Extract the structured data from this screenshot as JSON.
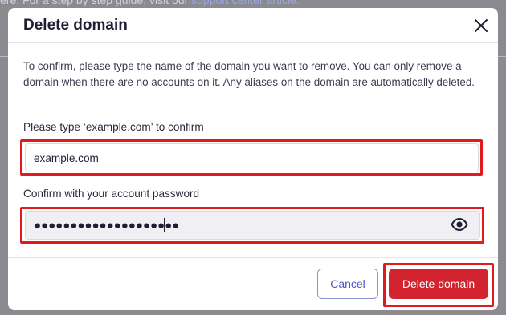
{
  "backdrop": {
    "text": "ere. For a step by step guide, visit our",
    "link": "support center article."
  },
  "modal": {
    "title": "Delete domain",
    "description": "To confirm, please type the name of the domain you want to remove. You can only remove a domain when there are no accounts on it. Any aliases on the domain are automatically deleted.",
    "domain_label": "Please type ‘example.com’ to confirm",
    "domain_value": "example.com",
    "password_label": "Confirm with your account password",
    "password_value": "●●●●●●●●●●●●●●●●●●●●",
    "cancel_label": "Cancel",
    "delete_label": "Delete domain"
  },
  "icons": {
    "close": "close-icon",
    "eye": "eye-icon"
  },
  "colors": {
    "accent": "#4b56c2",
    "danger": "#d2232e",
    "highlight": "#e11b1b"
  }
}
